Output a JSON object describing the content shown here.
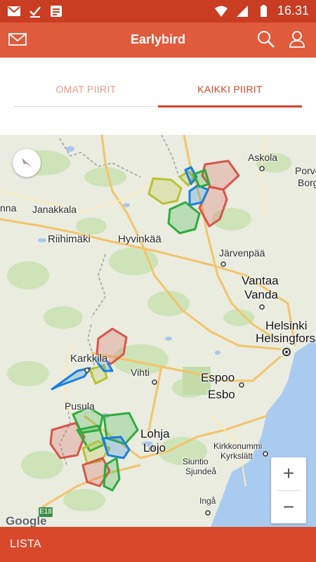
{
  "status_bar": {
    "time": "16.31",
    "icons": [
      "gmail-icon",
      "check-icon",
      "notes-icon",
      "wifi-icon",
      "signal-icon",
      "battery-icon"
    ]
  },
  "app_bar": {
    "title": "Earlybird",
    "icons": [
      "mail-icon",
      "search-icon",
      "user-icon"
    ]
  },
  "tabs": [
    {
      "label": "OMAT PIIRIT",
      "selected": false
    },
    {
      "label": "KAIKKI PIIRIT",
      "selected": true
    }
  ],
  "map": {
    "labels": {
      "askola": "Askola",
      "porvo": "Porvo",
      "borga": "Borg",
      "janakkala": "Janakkala",
      "hana": "nna",
      "riihimaki": "Riihimäki",
      "hyvinkaa": "Hyvinkää",
      "jarvenpaa": "Järvenpää",
      "vantaa": "Vantaa",
      "vanda": "Vanda",
      "helsinki": "Helsinki",
      "helsingfors": "Helsingfors",
      "karkkila": "Karkkila",
      "vihti": "Vihti",
      "espoo": "Espoo",
      "esbo": "Esbo",
      "pusula": "Pusula",
      "lohja": "Lohja",
      "lojo": "Lojo",
      "kirkkonummi": "Kirkkonummi",
      "kyrkslatt": "Kyrkslätt",
      "siuntio": "Siuntio",
      "sjundea": "Sjundeå",
      "inga": "Ingå",
      "route": "E18",
      "google": "Google"
    },
    "zoom_in": "+",
    "zoom_out": "−",
    "district_colors": {
      "red": "#d9544a",
      "green": "#2eaa3c",
      "blue": "#1a7fe0",
      "yellow": "#b8c234"
    }
  },
  "bottom_bar": {
    "label": "LISTA"
  }
}
